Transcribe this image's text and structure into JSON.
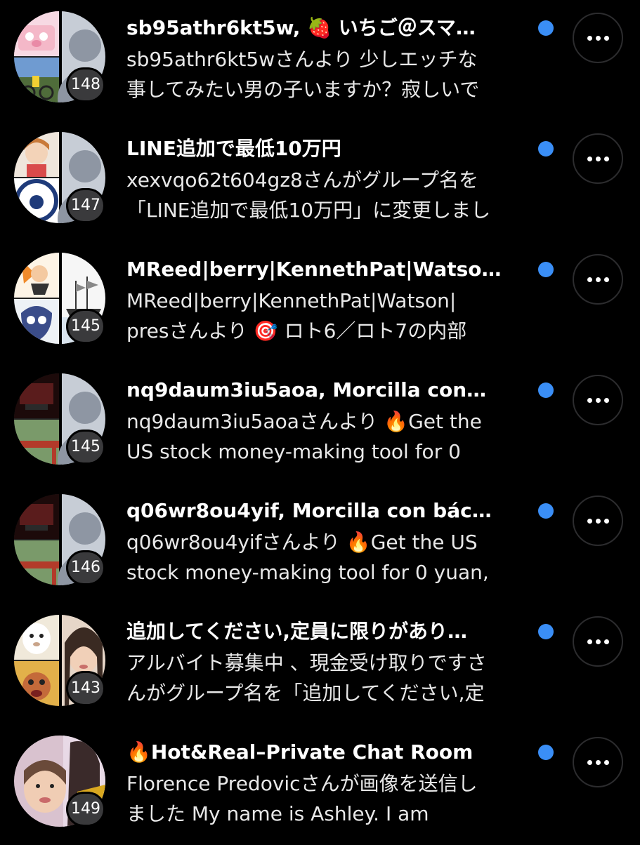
{
  "conversations": [
    {
      "title": "sb95athr6kt5w, 🍓 いちご＠スマ…",
      "preview_line1": "sb95athr6kt5wさんより 少しエッチな",
      "preview_line2": "事してみたい男の子いますか？寂しいで",
      "member_count": "148",
      "unread": true,
      "avatar_colors": [
        "#f3c9d6",
        "#3d6ea8"
      ]
    },
    {
      "title": "LINE追加で最低10万円",
      "preview_line1": "xexvqo62t604gz8さんがグループ名を",
      "preview_line2": "「LINE追加で最低10万円」に変更しまし",
      "member_count": "147",
      "unread": true,
      "avatar_colors": [
        "#e9dccd",
        "#f2f2f2"
      ]
    },
    {
      "title": "MReed|berry|KennethPat|Watso…",
      "preview_line1": "MReed|berry|KennethPat|Watson|",
      "preview_line2": "presさんより 🎯 ロト6／ロト7の内部",
      "member_count": "145",
      "unread": true,
      "avatar_colors": [
        "#f0a040",
        "#eeeeee"
      ]
    },
    {
      "title": "nq9daum3iu5aoa, Morcilla con…",
      "preview_line1": "nq9daum3iu5aoaさんより 🔥Get the",
      "preview_line2": "US stock money-making tool for 0",
      "member_count": "145",
      "unread": true,
      "avatar_colors": [
        "#3a1010",
        "#5d7a4a"
      ]
    },
    {
      "title": "q06wr8ou4yif, Morcilla con bác…",
      "preview_line1": "q06wr8ou4yifさんより 🔥Get the US",
      "preview_line2": "stock money-making tool for 0 yuan,",
      "member_count": "146",
      "unread": true,
      "avatar_colors": [
        "#3a1010",
        "#5d7a4a"
      ]
    },
    {
      "title": "追加してください,定員に限りがあり…",
      "preview_line1": "アルバイト募集中 、現金受け取りですさ",
      "preview_line2": "んがグループ名を「追加してください,定",
      "member_count": "143",
      "unread": true,
      "avatar_colors": [
        "#e8dcc4",
        "#c08a6a"
      ]
    },
    {
      "title": "🔥Hot&Real–Private Chat Room",
      "preview_line1": "Florence Predovicさんが画像を送信し",
      "preview_line2": "ました My name is Ashley. I am",
      "member_count": "149",
      "unread": true,
      "avatar_colors": [
        "#d8b9c6",
        "#c9a070"
      ]
    }
  ],
  "icons": {
    "more": "more-horizontal-icon",
    "unread": "unread-dot-icon"
  },
  "colors": {
    "background": "#000000",
    "unread_dot": "#3a8ef6",
    "badge_bg": "#3a3a3c"
  }
}
